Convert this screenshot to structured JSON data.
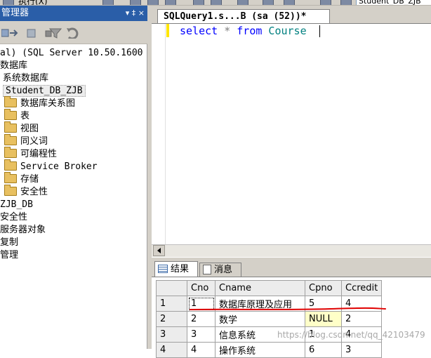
{
  "toolbar": {
    "execute_label": "执行(X)",
    "database_selector": "Student_DB_ZJB"
  },
  "object_explorer": {
    "title": "管理器",
    "title_buttons": "▾ ‡ ×",
    "server_node": "al) (SQL Server 10.50.1600",
    "tree": [
      {
        "label": "数据库",
        "indent": 0,
        "icon": "none"
      },
      {
        "label": "系统数据库",
        "indent": 1,
        "icon": "none"
      },
      {
        "label": "Student_DB_ZJB",
        "indent": 1,
        "icon": "database",
        "selected": true
      },
      {
        "label": "数据库关系图",
        "indent": 2,
        "icon": "folder"
      },
      {
        "label": "表",
        "indent": 2,
        "icon": "folder"
      },
      {
        "label": "视图",
        "indent": 2,
        "icon": "folder"
      },
      {
        "label": "同义词",
        "indent": 2,
        "icon": "folder"
      },
      {
        "label": "可编程性",
        "indent": 2,
        "icon": "folder"
      },
      {
        "label": "Service Broker",
        "indent": 2,
        "icon": "folder"
      },
      {
        "label": "存储",
        "indent": 2,
        "icon": "folder"
      },
      {
        "label": "安全性",
        "indent": 2,
        "icon": "folder"
      },
      {
        "label": "ZJB_DB",
        "indent": 0,
        "icon": "none"
      },
      {
        "label": "安全性",
        "indent": 0,
        "icon": "none"
      },
      {
        "label": "服务器对象",
        "indent": 0,
        "icon": "none"
      },
      {
        "label": "复制",
        "indent": 0,
        "icon": "none"
      },
      {
        "label": "管理",
        "indent": 0,
        "icon": "none"
      }
    ]
  },
  "query_tab": {
    "title": "SQLQuery1.s...B (sa (52))*"
  },
  "editor": {
    "tokens": [
      {
        "text": "select",
        "kind": "kw"
      },
      {
        "text": " * ",
        "kind": "op"
      },
      {
        "text": "from",
        "kind": "kw"
      },
      {
        "text": " Course",
        "kind": "ident"
      }
    ]
  },
  "results": {
    "tabs": {
      "results": "结果",
      "messages": "消息"
    },
    "columns": [
      "Cno",
      "Cname",
      "Cpno",
      "Ccredit"
    ],
    "rows": [
      {
        "row": "1",
        "cells": [
          "1",
          "数据库原理及应用",
          "5",
          "4"
        ]
      },
      {
        "row": "2",
        "cells": [
          "2",
          "数学",
          "NULL",
          "2"
        ]
      },
      {
        "row": "3",
        "cells": [
          "3",
          "信息系统",
          "1",
          "4"
        ]
      },
      {
        "row": "4",
        "cells": [
          "4",
          "操作系统",
          "6",
          "3"
        ]
      }
    ]
  },
  "watermark": "https://blog.csdn.net/qq_42103479",
  "colors": {
    "keyword": "#0000ff",
    "identifier": "#008080",
    "operator": "#808080",
    "title_bar": "#2a5ea8",
    "null_cell": "#ffffc8",
    "annotation": "#e00000"
  }
}
